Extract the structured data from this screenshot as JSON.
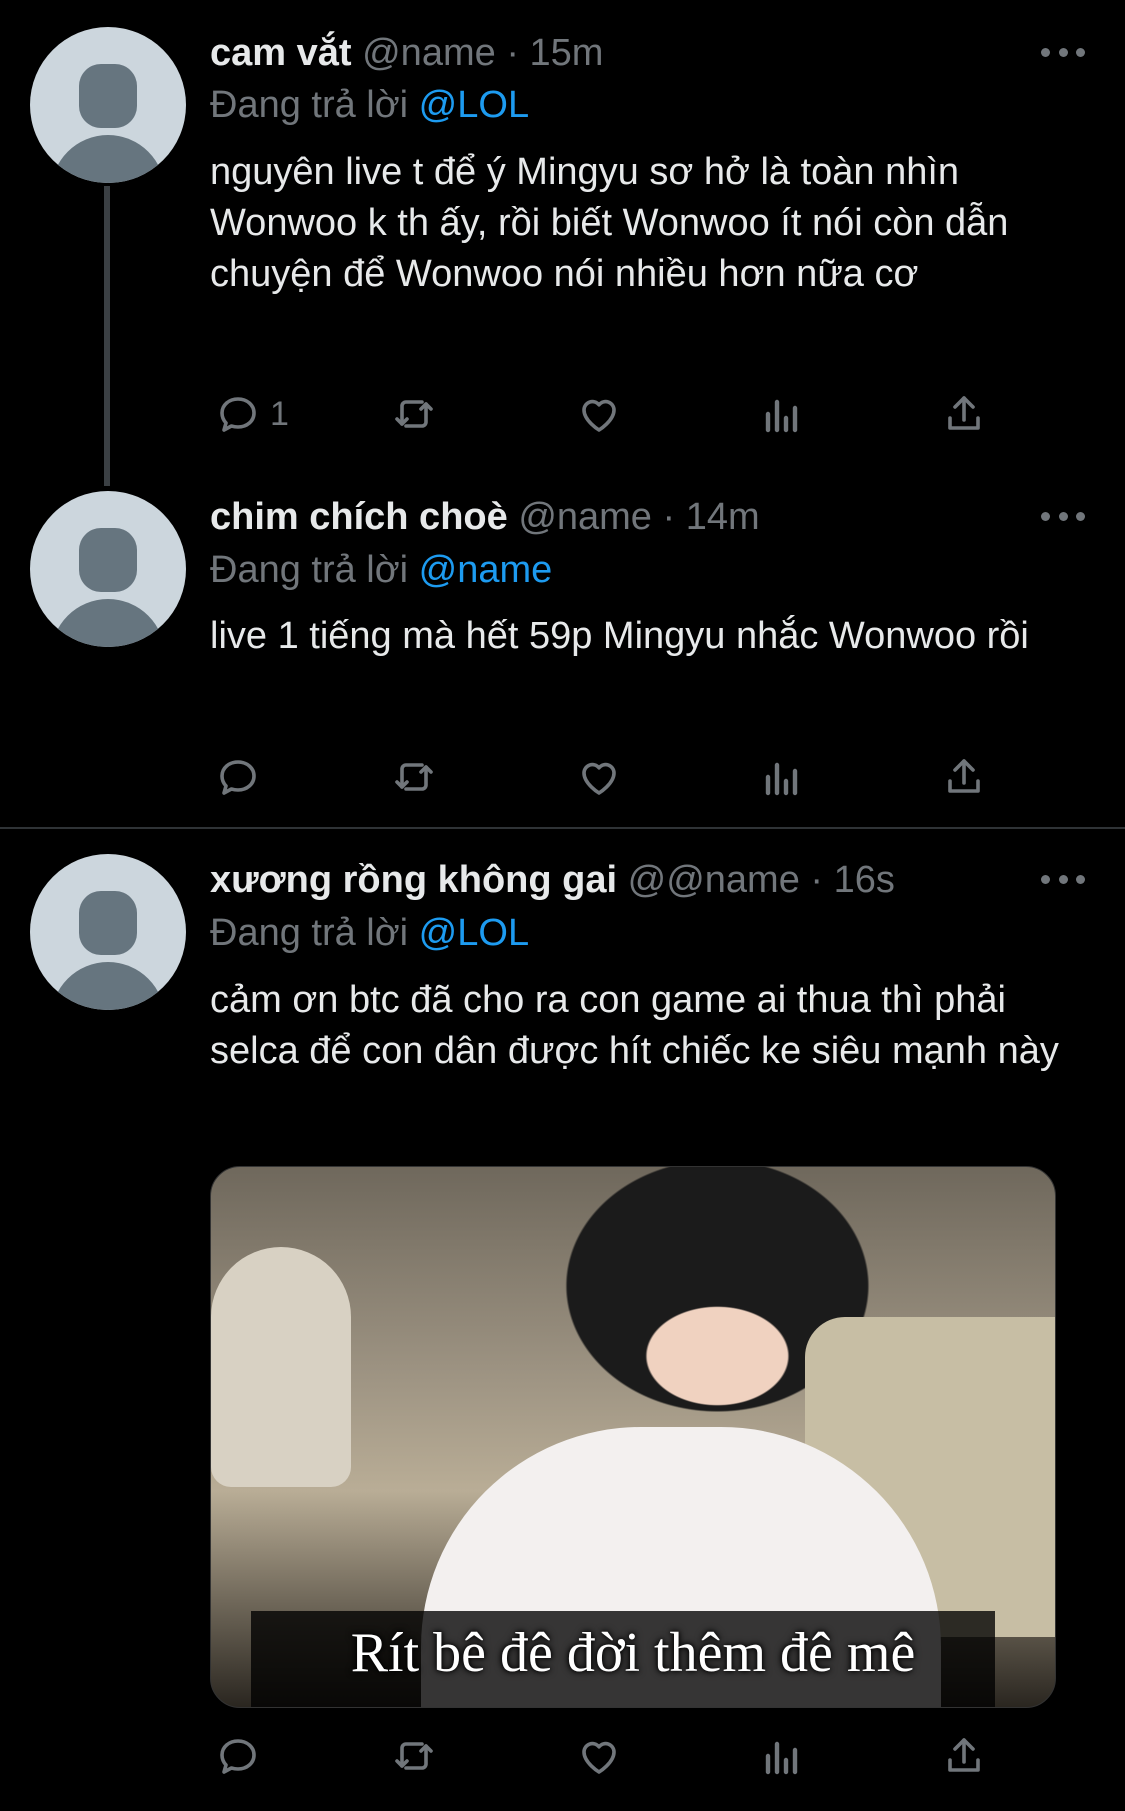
{
  "tweets": [
    {
      "name": "cam vắt",
      "handle": "@name",
      "time": "15m",
      "replying_prefix": "Đang trả lời",
      "replying_to": "@LOL",
      "text": "nguyên live t để ý Mingyu sơ hở là toàn nhìn Wonwoo k th ấy, rồi biết Wonwoo ít nói còn dẫn chuyện để Wonwoo nói nhiều hơn nữa cơ",
      "reply_count": "1"
    },
    {
      "name": "chim chích choè",
      "handle": "@name",
      "time": "14m",
      "replying_prefix": "Đang trả lời",
      "replying_to": "@name",
      "text": "live 1 tiếng mà hết 59p Mingyu nhắc Wonwoo rồi",
      "reply_count": ""
    },
    {
      "name": "xương rồng không gai",
      "handle": "@@name",
      "time": "16s",
      "replying_prefix": "Đang trả lời",
      "replying_to": "@LOL",
      "text": "cảm ơn btc đã cho ra con game ai thua thì phải selca để con dân được hít chiếc ke siêu mạnh này",
      "reply_count": "",
      "media_caption": "Rít bê đê đời thêm đê mê"
    }
  ],
  "icons": {
    "reply": "reply-icon",
    "retweet": "retweet-icon",
    "like": "heart-icon",
    "views": "views-icon",
    "share": "share-icon",
    "more": "more-icon"
  },
  "colors": {
    "background": "#000000",
    "text": "#e7e9ea",
    "muted": "#71767b",
    "link": "#1d9bf0"
  }
}
